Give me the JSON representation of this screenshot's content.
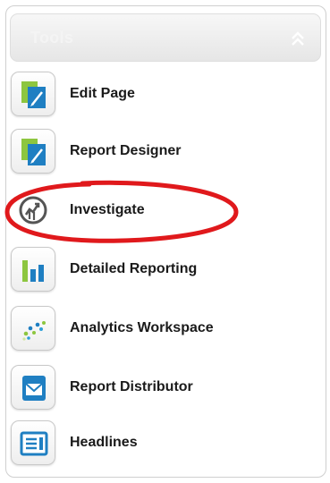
{
  "panel": {
    "title": "Tools",
    "collapse_icon": "double-chevron-up-icon"
  },
  "tools": [
    {
      "label": "Edit Page",
      "icon": "edit-page-icon"
    },
    {
      "label": "Report Designer",
      "icon": "report-designer-icon"
    },
    {
      "label": "Investigate",
      "icon": "investigate-icon"
    },
    {
      "label": "Detailed Reporting",
      "icon": "bar-chart-icon"
    },
    {
      "label": "Analytics Workspace",
      "icon": "scatter-dots-icon"
    },
    {
      "label": "Report Distributor",
      "icon": "envelope-icon"
    },
    {
      "label": "Headlines",
      "icon": "newspaper-icon"
    }
  ],
  "annotation": {
    "color": "#e0191c"
  }
}
